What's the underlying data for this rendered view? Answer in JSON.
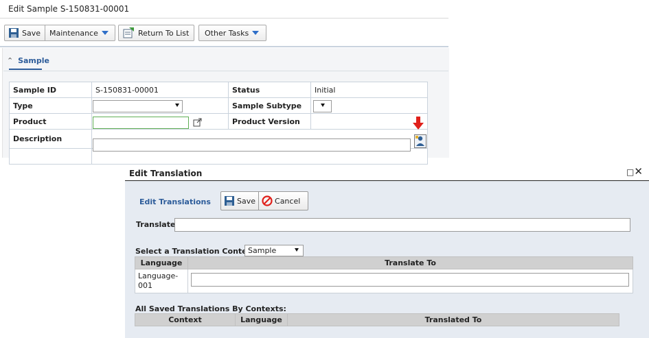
{
  "page": {
    "title": "Edit Sample S-150831-00001"
  },
  "toolbar": {
    "save_label": "Save",
    "maintenance_label": "Maintenance",
    "return_label": "Return To List",
    "other_tasks_label": "Other Tasks"
  },
  "section": {
    "title": "Sample",
    "collapse_icon": "chevron-up-icon"
  },
  "form": {
    "sample_id_label": "Sample ID",
    "sample_id_value": "S-150831-00001",
    "status_label": "Status",
    "status_value": "Initial",
    "type_label": "Type",
    "type_value": "",
    "sample_subtype_label": "Sample Subtype",
    "sample_subtype_value": "",
    "product_label": "Product",
    "product_value": "",
    "product_version_label": "Product Version",
    "product_version_value": "",
    "description_label": "Description",
    "description_value": ""
  },
  "dialog": {
    "title": "Edit Translation",
    "edit_translations_label": "Edit Translations",
    "save_label": "Save",
    "cancel_label": "Cancel",
    "translate_label": "Translate",
    "translate_value": "",
    "context_label": "Select a Translation Context:",
    "context_value": "Sample",
    "table": {
      "headers": [
        "Language",
        "Translate To"
      ],
      "rows": [
        {
          "language": "Language-\n001",
          "translate_to": ""
        }
      ]
    },
    "saved_label": "All Saved Translations By Contexts:",
    "saved_table": {
      "headers": [
        "Context",
        "Language",
        "Translated To"
      ]
    }
  },
  "colors": {
    "accent": "#2d5c9a",
    "arrow": "#e0201a",
    "dialog_bg": "#e6ebf2"
  }
}
